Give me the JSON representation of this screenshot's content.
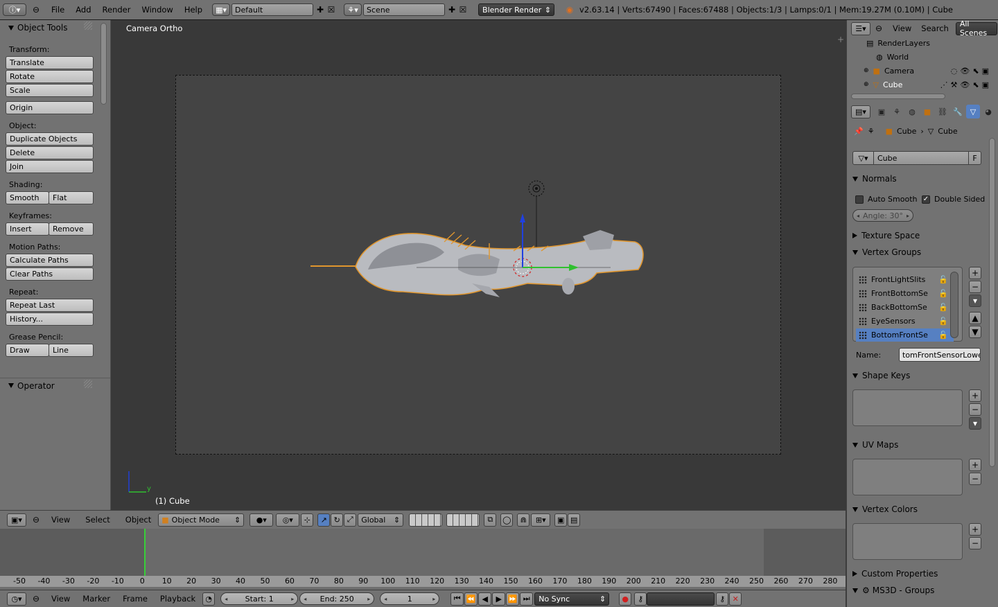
{
  "topbar": {
    "menus": [
      "File",
      "Add",
      "Render",
      "Window",
      "Help"
    ],
    "screen_layout": "Default",
    "scene": "Scene",
    "render_engine": "Blender Render",
    "stats": "v2.63.14 | Verts:67490 | Faces:67488 | Objects:1/3 | Lamps:0/1 | Mem:19.27M (0.10M) | Cube"
  },
  "toolshelf": {
    "title": "Object Tools",
    "transform_label": "Transform:",
    "translate": "Translate",
    "rotate": "Rotate",
    "scale": "Scale",
    "origin": "Origin",
    "object_label": "Object:",
    "duplicate": "Duplicate Objects",
    "delete": "Delete",
    "join": "Join",
    "shading_label": "Shading:",
    "smooth": "Smooth",
    "flat": "Flat",
    "keyframes_label": "Keyframes:",
    "insert": "Insert",
    "remove": "Remove",
    "motion_label": "Motion Paths:",
    "calc_paths": "Calculate Paths",
    "clear_paths": "Clear Paths",
    "repeat_label": "Repeat:",
    "repeat_last": "Repeat Last",
    "history": "History...",
    "grease_label": "Grease Pencil:",
    "draw": "Draw",
    "line": "Line",
    "operator": "Operator"
  },
  "viewport": {
    "view_label": "Camera Ortho",
    "object_label": "(1) Cube",
    "axis_y": "y"
  },
  "view_header": {
    "menus": [
      "View",
      "Select",
      "Object"
    ],
    "mode": "Object Mode",
    "orientation": "Global"
  },
  "timeline": {
    "ticks": [
      "-50",
      "-40",
      "-30",
      "-20",
      "-10",
      "0",
      "10",
      "20",
      "30",
      "40",
      "50",
      "60",
      "70",
      "80",
      "90",
      "100",
      "110",
      "120",
      "130",
      "140",
      "150",
      "160",
      "170",
      "180",
      "190",
      "200",
      "210",
      "220",
      "230",
      "240",
      "250",
      "260",
      "270",
      "280"
    ],
    "current_frame": "1",
    "menus": [
      "View",
      "Marker",
      "Frame",
      "Playback"
    ],
    "start": "Start: 1",
    "end": "End: 250",
    "frame": "1",
    "sync": "No Sync"
  },
  "outliner": {
    "menus": [
      "View",
      "Search"
    ],
    "filter": "All Scenes",
    "rows": [
      "RenderLayers",
      "World",
      "Camera",
      "Cube"
    ]
  },
  "properties": {
    "breadcrumb_object": "Cube",
    "breadcrumb_data": "Cube",
    "mesh_name": "Cube",
    "fake_user": "F",
    "normals": "Normals",
    "auto_smooth": "Auto Smooth",
    "double_sided": "Double Sided",
    "angle": "Angle: 30°",
    "texture_space": "Texture Space",
    "vertex_groups": "Vertex Groups",
    "groups": [
      "FrontLightSlits",
      "FrontBottomSe",
      "BackBottomSe",
      "EyeSensors",
      "BottomFrontSe"
    ],
    "name_label": "Name:",
    "name_value": "tomFrontSensorLower",
    "shape_keys": "Shape Keys",
    "uv_maps": "UV Maps",
    "vertex_colors": "Vertex Colors",
    "custom_props": "Custom Properties",
    "ms3d_groups": "MS3D - Groups"
  },
  "colors": {
    "selection_blue": "#5680c2",
    "frame_cursor": "#38d038",
    "outline_orange": "#e0962e"
  }
}
